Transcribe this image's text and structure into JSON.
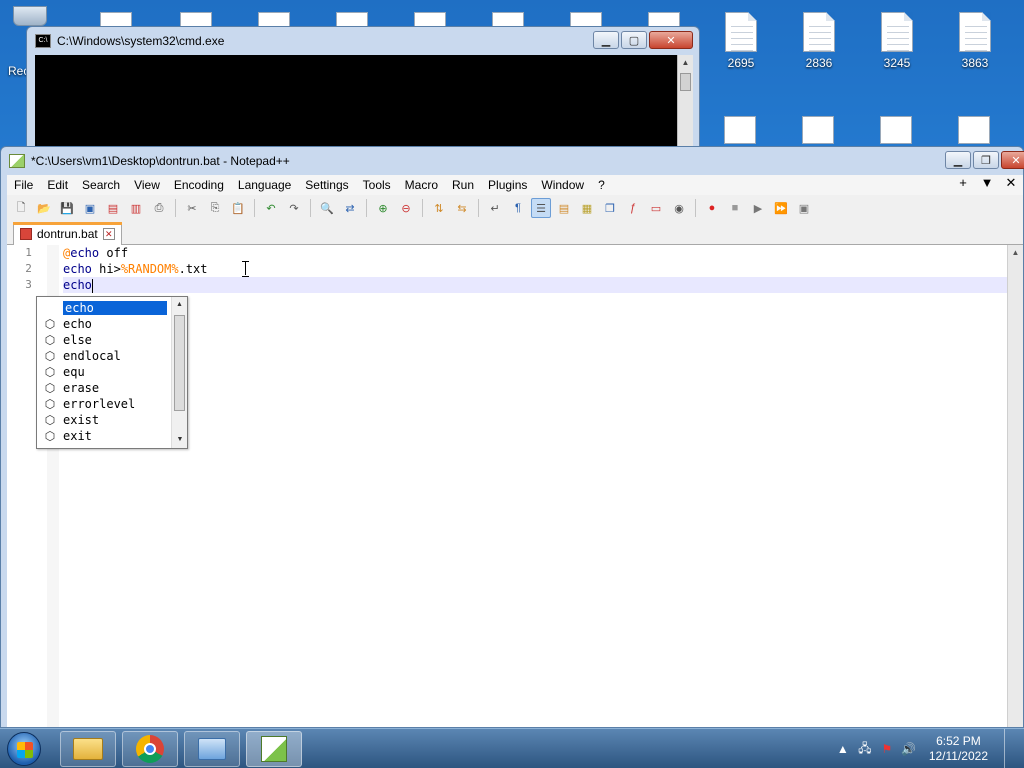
{
  "desktop": {
    "icons": [
      {
        "label": "2695"
      },
      {
        "label": "2836"
      },
      {
        "label": "3245"
      },
      {
        "label": "3863"
      }
    ],
    "recycle_label_partial": "Rec"
  },
  "cmd": {
    "title": "C:\\Windows\\system32\\cmd.exe"
  },
  "npp": {
    "title": "*C:\\Users\\vm1\\Desktop\\dontrun.bat - Notepad++",
    "menu": [
      "File",
      "Edit",
      "Search",
      "View",
      "Encoding",
      "Language",
      "Settings",
      "Tools",
      "Macro",
      "Run",
      "Plugins",
      "Window",
      "?"
    ],
    "menu_right": [
      "+",
      "▼",
      "✕"
    ],
    "tab": {
      "label": "dontrun.bat"
    },
    "lines": [
      {
        "num": "1",
        "parts": [
          {
            "t": "@",
            "c": "at"
          },
          {
            "t": "echo",
            "c": "kw"
          },
          {
            "t": " off",
            "c": ""
          }
        ]
      },
      {
        "num": "2",
        "parts": [
          {
            "t": "echo",
            "c": "kw"
          },
          {
            "t": " hi>",
            "c": ""
          },
          {
            "t": "%RANDOM%",
            "c": "var"
          },
          {
            "t": ".txt",
            "c": ""
          }
        ]
      },
      {
        "num": "3",
        "parts": [
          {
            "t": "echo",
            "c": "kw"
          }
        ]
      }
    ],
    "autocomplete": {
      "items": [
        "echo",
        "echo",
        "else",
        "endlocal",
        "equ",
        "erase",
        "errorlevel",
        "exist",
        "exit"
      ],
      "selected_index": 0
    }
  },
  "taskbar": {
    "clock_time": "6:52 PM",
    "clock_date": "12/11/2022"
  }
}
